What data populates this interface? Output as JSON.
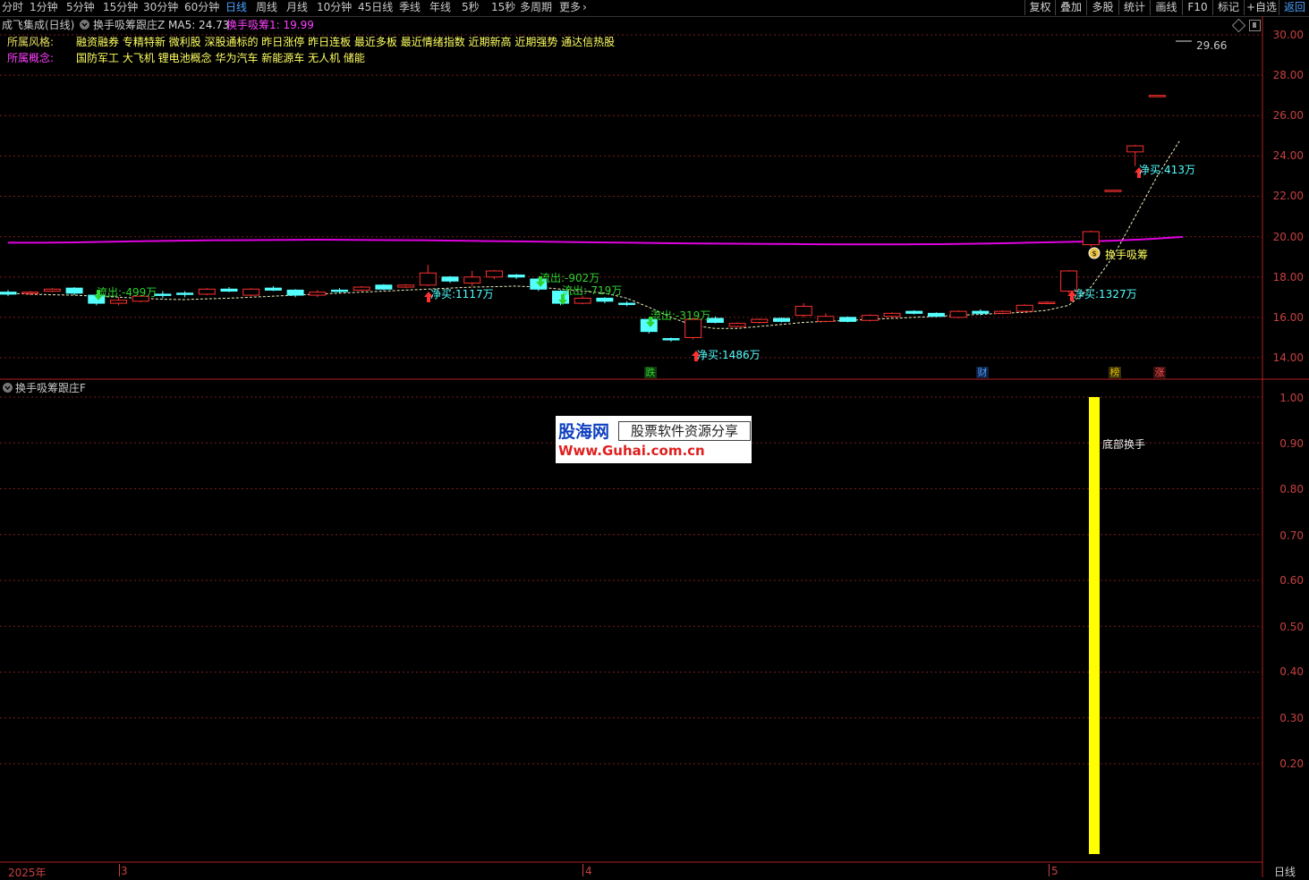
{
  "period_bar": {
    "items": [
      "分时",
      "1分钟",
      "5分钟",
      "15分钟",
      "30分钟",
      "60分钟",
      "日线",
      "周线",
      "月线",
      "10分钟",
      "45日线",
      "季线",
      "年线",
      "5秒",
      "15秒",
      "多周期",
      "更多"
    ],
    "active": "日线",
    "more_chevron": "chevron-right-icon",
    "right_buttons": [
      "复权",
      "叠加",
      "多股",
      "统计",
      "画线",
      "F10",
      "标记",
      "+自选",
      "返回"
    ]
  },
  "main_header": {
    "stock": "成飞集成(日线)",
    "indicator": "换手吸筹跟庄Z",
    "ma5_label": "MA5: 24.73",
    "xichou_label": "换手吸筹1: 19.99"
  },
  "tags": {
    "style_label": "所属风格:",
    "style_value": "融资融券 专精特新 微利股 深股通标的 昨日涨停 昨日连板 最近多板 最近情绪指数 近期新高 近期强势 通达信热股",
    "concept_label": "所属概念:",
    "concept_value": "国防军工 大飞机 锂电池概念 华为汽车 新能源车 无人机 储能"
  },
  "price_axis": [
    "30.00",
    "28.00",
    "26.00",
    "24.00",
    "22.00",
    "20.00",
    "18.00",
    "16.00",
    "14.00"
  ],
  "annotations": {
    "price_high": "29.66",
    "out1": "流出:-499万",
    "buy1": "净买:1117万",
    "out2": "流出:-902万",
    "out3": "流出:-719万",
    "out4": "流出:-319万",
    "buy2": "净买:1486万",
    "buy3": "净买:1327万",
    "buy4": "净买:413万",
    "xichou": "换手吸筹"
  },
  "event_marks": [
    {
      "label": "跌",
      "color": "#2fd22f"
    },
    {
      "label": "财",
      "color": "#4a9eff"
    },
    {
      "label": "榜",
      "color": "#e0c000"
    },
    {
      "label": "涨",
      "color": "#ff3030"
    }
  ],
  "sub_header": {
    "indicator": "换手吸筹跟庄F"
  },
  "sub_axis": [
    "1.00",
    "0.90",
    "0.80",
    "0.70",
    "0.60",
    "0.50",
    "0.40",
    "0.30",
    "0.20"
  ],
  "sub_bar": {
    "label": "底部换手",
    "value": 1.0,
    "color": "#ffff00"
  },
  "bottom_axis": {
    "year": "2025年",
    "months": [
      "3",
      "4",
      "5"
    ],
    "period": "日线"
  },
  "watermark": {
    "brand": "股海网",
    "slogan": "股票软件资源分享",
    "url": "Www.Guhai.com.cn"
  },
  "colors": {
    "up": "#ff3030",
    "down": "#54ffff",
    "ma_line": "#e000e0",
    "grid": "#7a1c1c",
    "axis": "#c84040"
  },
  "candles": [
    {
      "o": 17.25,
      "c": 17.15,
      "h": 17.35,
      "l": 17.05
    },
    {
      "o": 17.2,
      "c": 17.25,
      "h": 17.3,
      "l": 17.1
    },
    {
      "o": 17.3,
      "c": 17.4,
      "h": 17.45,
      "l": 17.25
    },
    {
      "o": 17.45,
      "c": 17.2,
      "h": 17.5,
      "l": 17.1
    },
    {
      "o": 17.1,
      "c": 16.7,
      "h": 17.15,
      "l": 16.6
    },
    {
      "o": 16.7,
      "c": 16.85,
      "h": 17.0,
      "l": 16.6
    },
    {
      "o": 16.8,
      "c": 17.05,
      "h": 17.1,
      "l": 16.75
    },
    {
      "o": 17.15,
      "c": 17.1,
      "h": 17.3,
      "l": 16.95
    },
    {
      "o": 17.2,
      "c": 17.15,
      "h": 17.3,
      "l": 17.0
    },
    {
      "o": 17.15,
      "c": 17.4,
      "h": 17.45,
      "l": 17.1
    },
    {
      "o": 17.4,
      "c": 17.3,
      "h": 17.5,
      "l": 17.25
    },
    {
      "o": 17.1,
      "c": 17.4,
      "h": 17.45,
      "l": 17.05
    },
    {
      "o": 17.45,
      "c": 17.35,
      "h": 17.55,
      "l": 17.3
    },
    {
      "o": 17.35,
      "c": 17.1,
      "h": 17.4,
      "l": 17.0
    },
    {
      "o": 17.1,
      "c": 17.25,
      "h": 17.35,
      "l": 17.0
    },
    {
      "o": 17.35,
      "c": 17.3,
      "h": 17.45,
      "l": 17.2
    },
    {
      "o": 17.35,
      "c": 17.5,
      "h": 17.55,
      "l": 17.3
    },
    {
      "o": 17.6,
      "c": 17.4,
      "h": 17.65,
      "l": 17.35
    },
    {
      "o": 17.5,
      "c": 17.6,
      "h": 17.65,
      "l": 17.45
    },
    {
      "o": 17.6,
      "c": 18.2,
      "h": 18.6,
      "l": 17.55
    },
    {
      "o": 18.0,
      "c": 17.8,
      "h": 18.05,
      "l": 17.7
    },
    {
      "o": 17.7,
      "c": 18.0,
      "h": 18.3,
      "l": 17.55
    },
    {
      "o": 18.0,
      "c": 18.3,
      "h": 18.35,
      "l": 17.9
    },
    {
      "o": 18.1,
      "c": 18.0,
      "h": 18.15,
      "l": 17.9
    },
    {
      "o": 17.9,
      "c": 17.4,
      "h": 17.95,
      "l": 17.3
    },
    {
      "o": 17.3,
      "c": 16.7,
      "h": 17.35,
      "l": 16.6
    },
    {
      "o": 16.7,
      "c": 16.95,
      "h": 17.05,
      "l": 16.65
    },
    {
      "o": 16.95,
      "c": 16.8,
      "h": 17.0,
      "l": 16.7
    },
    {
      "o": 16.7,
      "c": 16.65,
      "h": 16.8,
      "l": 16.55
    },
    {
      "o": 15.9,
      "c": 15.3,
      "h": 15.95,
      "l": 15.2
    },
    {
      "o": 14.95,
      "c": 14.9,
      "h": 15.0,
      "l": 14.8
    },
    {
      "o": 15.0,
      "c": 15.9,
      "h": 16.0,
      "l": 14.9
    },
    {
      "o": 15.95,
      "c": 15.75,
      "h": 16.05,
      "l": 15.7
    },
    {
      "o": 15.55,
      "c": 15.7,
      "h": 15.75,
      "l": 15.5
    },
    {
      "o": 15.75,
      "c": 15.9,
      "h": 15.95,
      "l": 15.7
    },
    {
      "o": 15.95,
      "c": 15.8,
      "h": 16.0,
      "l": 15.75
    },
    {
      "o": 16.1,
      "c": 16.55,
      "h": 16.7,
      "l": 16.0
    },
    {
      "o": 15.8,
      "c": 16.05,
      "h": 16.2,
      "l": 15.75
    },
    {
      "o": 16.0,
      "c": 15.8,
      "h": 16.05,
      "l": 15.75
    },
    {
      "o": 15.85,
      "c": 16.1,
      "h": 16.15,
      "l": 15.8
    },
    {
      "o": 16.05,
      "c": 16.2,
      "h": 16.25,
      "l": 16.0
    },
    {
      "o": 16.3,
      "c": 16.2,
      "h": 16.35,
      "l": 16.15
    },
    {
      "o": 16.2,
      "c": 16.05,
      "h": 16.25,
      "l": 16.0
    },
    {
      "o": 16.0,
      "c": 16.3,
      "h": 16.35,
      "l": 15.95
    },
    {
      "o": 16.3,
      "c": 16.2,
      "h": 16.4,
      "l": 16.1
    },
    {
      "o": 16.2,
      "c": 16.3,
      "h": 16.35,
      "l": 16.15
    },
    {
      "o": 16.3,
      "c": 16.6,
      "h": 16.65,
      "l": 16.25
    },
    {
      "o": 16.7,
      "c": 16.75,
      "h": 16.8,
      "l": 16.65
    },
    {
      "o": 17.3,
      "c": 18.3,
      "h": 18.35,
      "l": 17.2
    },
    {
      "o": 19.6,
      "c": 20.25,
      "h": 20.3,
      "l": 19.5
    },
    {
      "o": 22.3,
      "c": 22.3,
      "h": 22.3,
      "l": 22.3
    },
    {
      "o": 24.2,
      "c": 24.5,
      "h": 24.55,
      "l": 23.5
    },
    {
      "o": 27.0,
      "c": 27.0,
      "h": 27.0,
      "l": 27.0
    }
  ],
  "ma_line": [
    17.2,
    17.15,
    17.12,
    17.1,
    17.05,
    17.0,
    16.95,
    16.9,
    16.88,
    16.92,
    16.95,
    17.0,
    17.05,
    17.1,
    17.15,
    17.2,
    17.25,
    17.3,
    17.35,
    17.4,
    17.45,
    17.5,
    17.52,
    17.55,
    17.5,
    17.4,
    17.3,
    17.2,
    16.95,
    16.5,
    16.0,
    15.6,
    15.45,
    15.45,
    15.55,
    15.65,
    15.75,
    15.8,
    15.85,
    15.9,
    15.95,
    16.0,
    16.05,
    16.1,
    16.15,
    16.2,
    16.25,
    16.35,
    16.6,
    17.5,
    19.0,
    21.0,
    23.0,
    24.73
  ],
  "hold_line": [
    19.7,
    19.7,
    19.72,
    19.75,
    19.78,
    19.8,
    19.82,
    19.83,
    19.84,
    19.85,
    19.84,
    19.83,
    19.82,
    19.8,
    19.78,
    19.76,
    19.74,
    19.72,
    19.7,
    19.68,
    19.66,
    19.65,
    19.64,
    19.63,
    19.62,
    19.62,
    19.62,
    19.63,
    19.65,
    19.68,
    19.72,
    19.75,
    19.8,
    19.88,
    19.99
  ]
}
